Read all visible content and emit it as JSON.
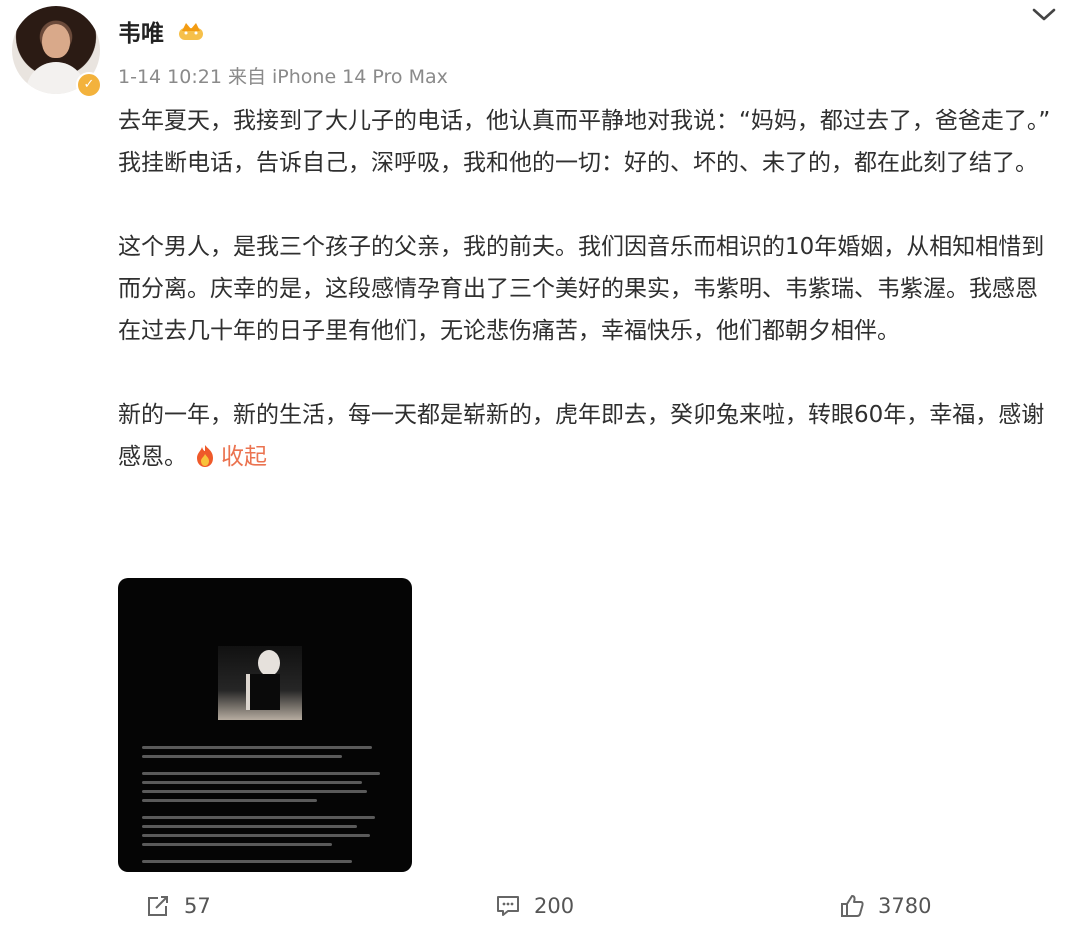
{
  "post": {
    "username": "韦唯",
    "meta": "1-14 10:21 来自 iPhone 14 Pro Max",
    "paragraphs": [
      "去年夏天，我接到了大儿子的电话，他认真而平静地对我说：“妈妈，都过去了，爸爸走了。” 我挂断电话，告诉自己，深呼吸，我和他的一切：好的、坏的、未了的，都在此刻了结了。",
      "这个男人，是我三个孩子的父亲，我的前夫。我们因音乐而相识的10年婚姻，从相知相惜到而分离。庆幸的是，这段感情孕育出了三个美好的果实，韦紫明、韦紫瑞、韦紫渥。我感恩在过去几十年的日子里有他们，无论悲伤痛苦，幸福快乐，他们都朝夕相伴。",
      "新的一年，新的生活，每一天都是崭新的，虎年即去，癸卯兔来啦，转眼60年，幸福，感谢感恩。"
    ],
    "collapse_label": "收起",
    "icons": {
      "vip": "crown-badge-icon",
      "verified": "verified-badge-icon",
      "menu": "chevron-down-icon",
      "collapse": "fire-emoji-icon"
    },
    "colors": {
      "accent": "#eb7350",
      "verified": "#f3b23c"
    }
  },
  "actions": {
    "repost_count": "57",
    "comment_count": "200",
    "like_count": "3780"
  }
}
